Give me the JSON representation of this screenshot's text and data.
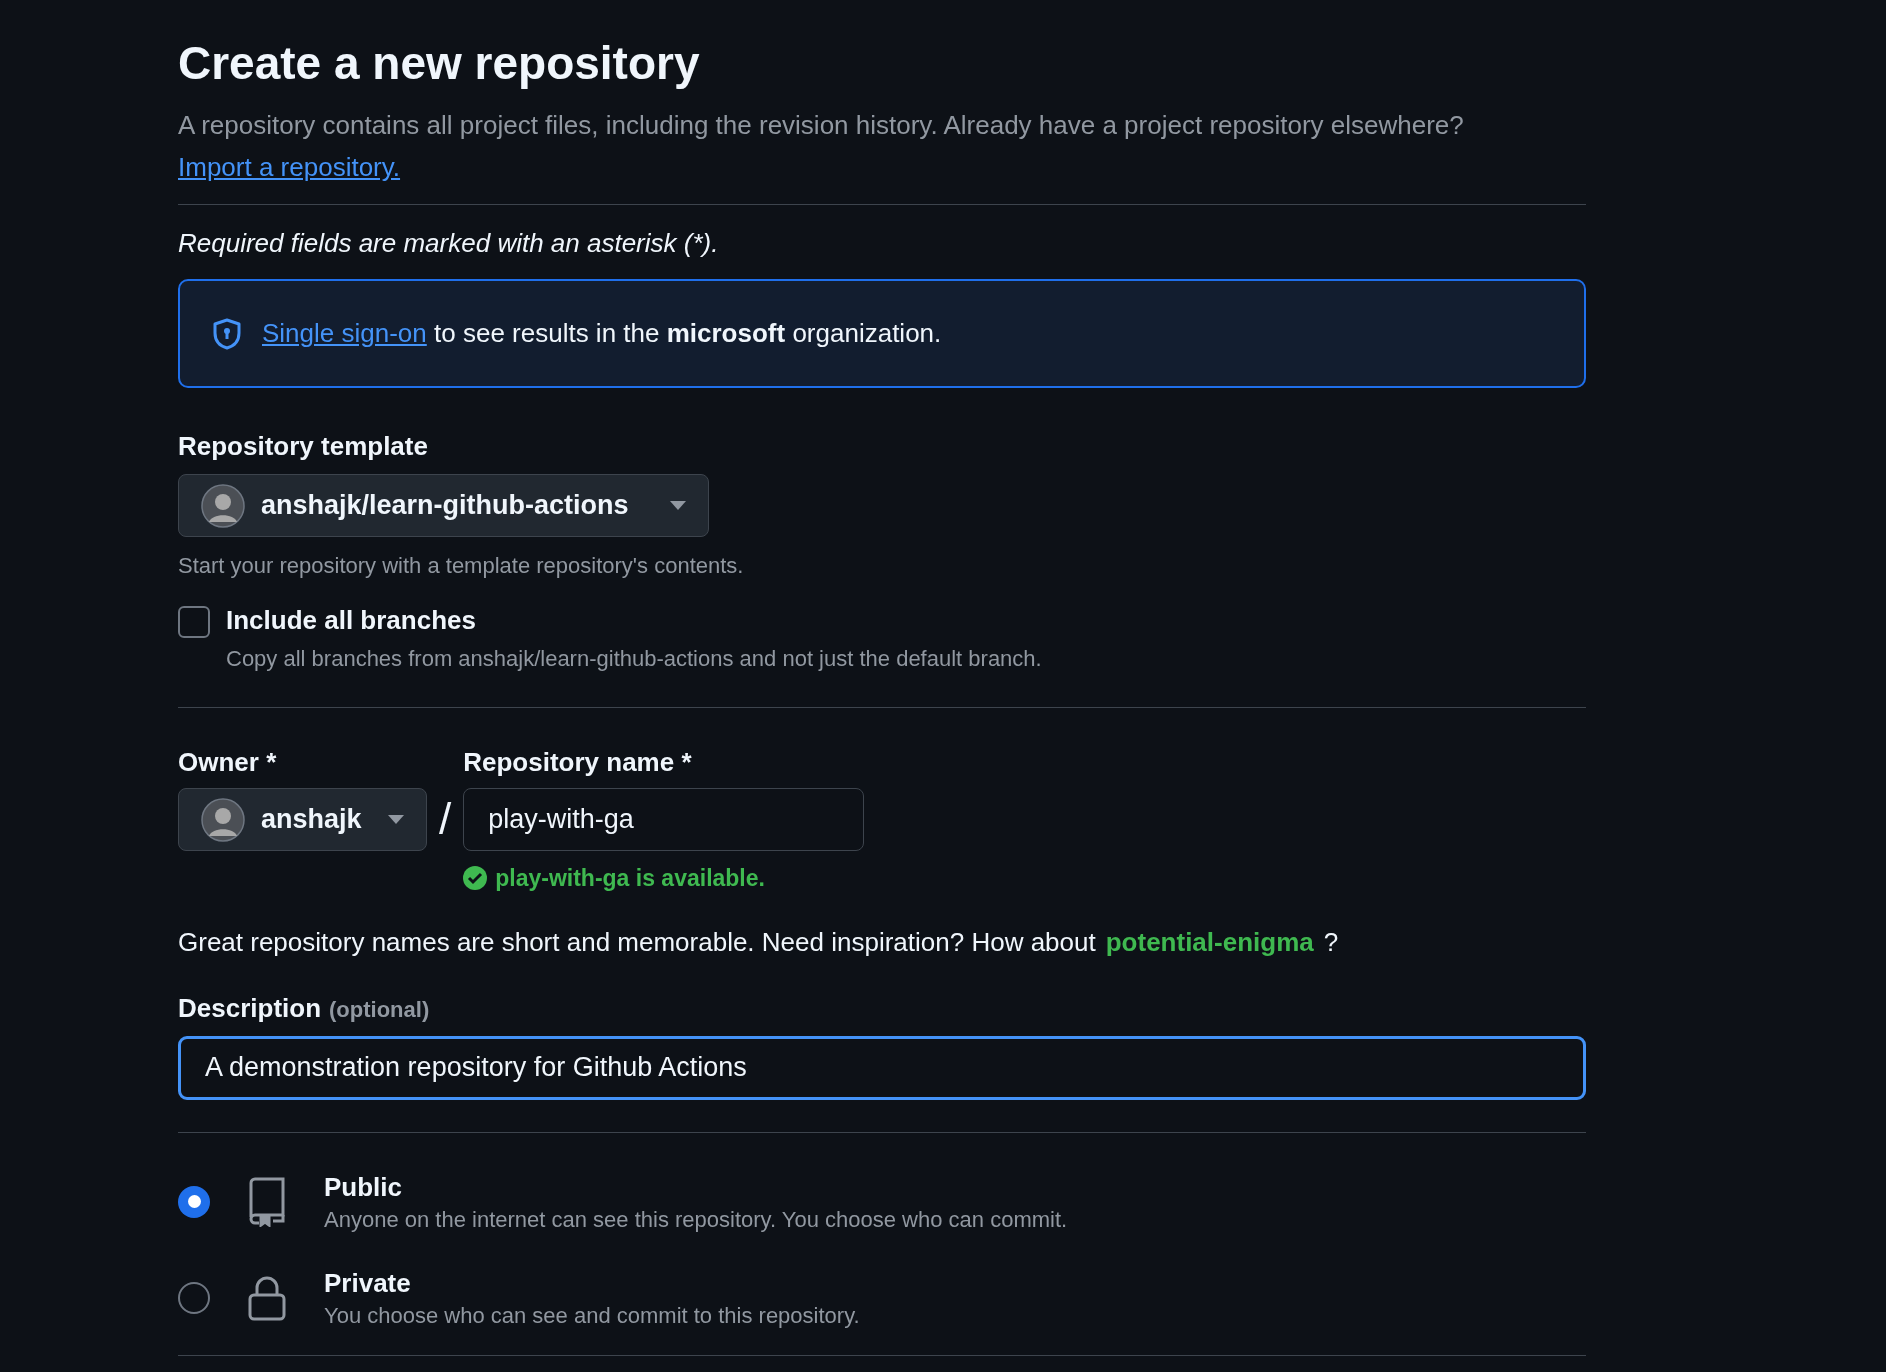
{
  "title": "Create a new repository",
  "intro": {
    "text": "A repository contains all project files, including the revision history. Already have a project repository elsewhere?",
    "link": "Import a repository."
  },
  "required_note": "Required fields are marked with an asterisk (*).",
  "sso_banner": {
    "link": "Single sign-on",
    "text": "to see results in the **microsoft** organization."
  },
  "template": {
    "label": "Repository template",
    "value": "anshajk/learn-github-actions",
    "hint": "Start your repository with a template repository's contents."
  },
  "include_branches": {
    "label": "Include all branches",
    "checked": false,
    "hint": "Copy all branches from anshajk/learn-github-actions and not just the default branch."
  },
  "owner": {
    "label": "Owner *",
    "value": "anshajk"
  },
  "separator": "/",
  "repo_name": {
    "label": "Repository name *",
    "value": "play-with-ga",
    "status": "play-with-ga is available."
  },
  "suggestion": {
    "text": "Great repository names are short and memorable. Need inspiration? How about",
    "name": "potential-enigma",
    "suffix": "?"
  },
  "description": {
    "label": "Description",
    "optional": "(optional)",
    "value": "A demonstration repository for Github Actions",
    "focused": true
  },
  "visibility": [
    {
      "kind": "public",
      "label": "Public",
      "hint": "Anyone on the internet can see this repository. You choose who can commit.",
      "selected": true
    },
    {
      "kind": "private",
      "label": "Private",
      "hint": "You choose who can see and commit to this repository.",
      "selected": false
    }
  ]
}
